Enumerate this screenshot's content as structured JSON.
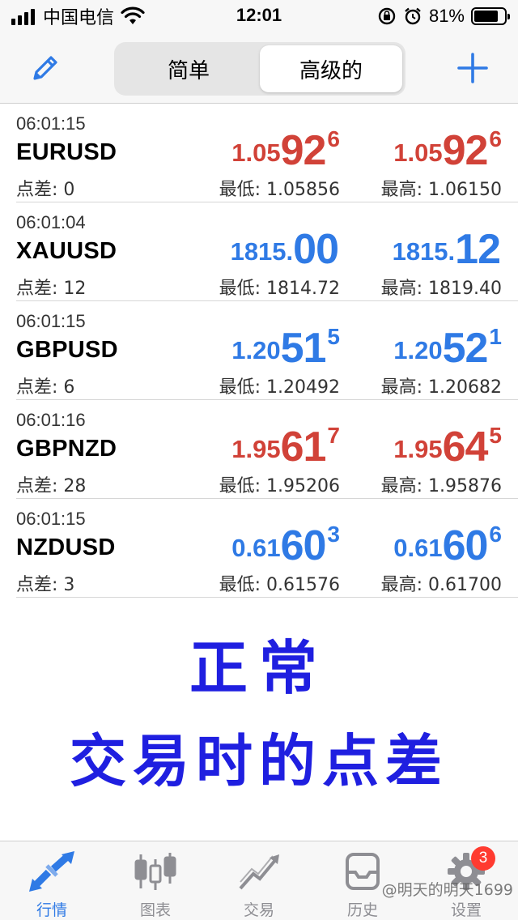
{
  "status_bar": {
    "carrier": "中国电信",
    "time": "12:01",
    "battery_percent": "81%",
    "battery_level": 0.81
  },
  "nav": {
    "segments": [
      {
        "label": "简单",
        "active": false
      },
      {
        "label": "高级的",
        "active": true
      }
    ]
  },
  "quotes": [
    {
      "time": "06:01:15",
      "symbol": "EURUSD",
      "spread": "点差: 0",
      "color": "#d14238",
      "bid": {
        "small": "1.05",
        "big": "92",
        "sup": "6"
      },
      "ask": {
        "small": "1.05",
        "big": "92",
        "sup": "6"
      },
      "low": "最低: 1.05856",
      "high": "最高: 1.06150"
    },
    {
      "time": "06:01:04",
      "symbol": "XAUUSD",
      "spread": "点差: 12",
      "color": "#2f7ae5",
      "bid": {
        "small": "1815.",
        "big": "00",
        "sup": ""
      },
      "ask": {
        "small": "1815.",
        "big": "12",
        "sup": ""
      },
      "low": "最低: 1814.72",
      "high": "最高: 1819.40"
    },
    {
      "time": "06:01:15",
      "symbol": "GBPUSD",
      "spread": "点差: 6",
      "color": "#2f7ae5",
      "bid": {
        "small": "1.20",
        "big": "51",
        "sup": "5"
      },
      "ask": {
        "small": "1.20",
        "big": "52",
        "sup": "1"
      },
      "low": "最低: 1.20492",
      "high": "最高: 1.20682"
    },
    {
      "time": "06:01:16",
      "symbol": "GBPNZD",
      "spread": "点差: 28",
      "color": "#d14238",
      "bid": {
        "small": "1.95",
        "big": "61",
        "sup": "7"
      },
      "ask": {
        "small": "1.95",
        "big": "64",
        "sup": "5"
      },
      "low": "最低: 1.95206",
      "high": "最高: 1.95876"
    },
    {
      "time": "06:01:15",
      "symbol": "NZDUSD",
      "spread": "点差: 3",
      "color": "#2f7ae5",
      "bid": {
        "small": "0.61",
        "big": "60",
        "sup": "3"
      },
      "ask": {
        "small": "0.61",
        "big": "60",
        "sup": "6"
      },
      "low": "最低: 0.61576",
      "high": "最高: 0.61700"
    }
  ],
  "overlay": {
    "line1": "正常",
    "line2": "交易时的点差"
  },
  "tabs": [
    {
      "label": "行情",
      "icon": "quotes-arrows-icon",
      "active": true
    },
    {
      "label": "图表",
      "icon": "candlestick-chart-icon",
      "active": false
    },
    {
      "label": "交易",
      "icon": "trade-trend-icon",
      "active": false
    },
    {
      "label": "历史",
      "icon": "history-icon",
      "active": false
    },
    {
      "label": "设置",
      "icon": "gear-icon",
      "active": false,
      "badge": "3"
    }
  ],
  "watermark": "@明天的明天1699",
  "colors": {
    "accent": "#2f7ae5",
    "down_red": "#d14238",
    "overlay_blue": "#1f1fe0",
    "badge_red": "#ff3b30"
  }
}
